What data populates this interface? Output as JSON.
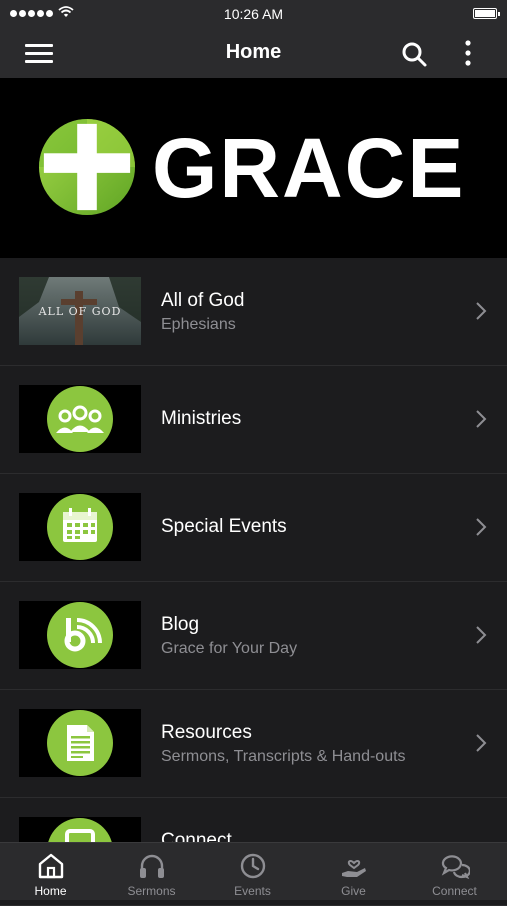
{
  "status_bar": {
    "time": "10:26 AM"
  },
  "header": {
    "title": "Home"
  },
  "banner": {
    "logo_text": "GRACE"
  },
  "list": [
    {
      "title": "All of God",
      "subtitle": "Ephesians",
      "thumb": "sermon-image",
      "thumb_text": "ALL OF GOD"
    },
    {
      "title": "Ministries",
      "subtitle": "",
      "thumb": "people-icon"
    },
    {
      "title": "Special Events",
      "subtitle": "",
      "thumb": "calendar-icon"
    },
    {
      "title": "Blog",
      "subtitle": "Grace for Your Day",
      "thumb": "blog-icon"
    },
    {
      "title": "Resources",
      "subtitle": "Sermons, Transcripts & Hand-outs",
      "thumb": "document-icon"
    },
    {
      "title": "Connect",
      "subtitle": "",
      "thumb": "tablet-icon"
    }
  ],
  "tabs": [
    {
      "label": "Home",
      "icon": "home-icon",
      "active": true
    },
    {
      "label": "Sermons",
      "icon": "headphones-icon",
      "active": false
    },
    {
      "label": "Events",
      "icon": "clock-icon",
      "active": false
    },
    {
      "label": "Give",
      "icon": "give-hand-icon",
      "active": false
    },
    {
      "label": "Connect",
      "icon": "chat-bubbles-icon",
      "active": false
    }
  ],
  "colors": {
    "accent_green": "#8cc63f",
    "background": "#1c1c1e",
    "bar": "#2b2b2d",
    "subtitle_gray": "#8e8e93"
  }
}
